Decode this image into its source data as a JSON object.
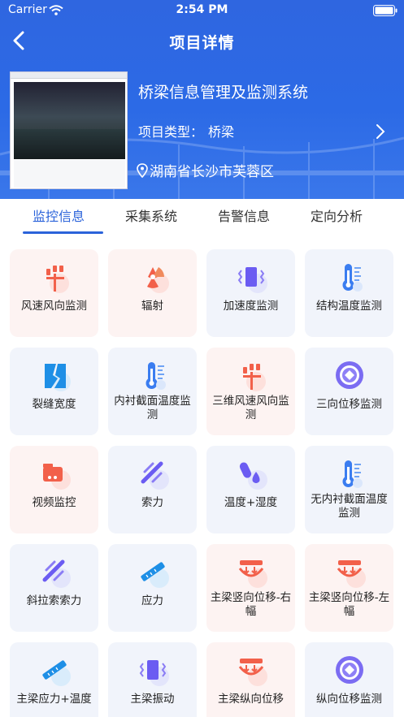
{
  "status_bar": {
    "carrier": "Carrier",
    "time": "2:54 PM"
  },
  "nav": {
    "title": "项目详情"
  },
  "project": {
    "name": "桥梁信息管理及监测系统",
    "type_label": "项目类型：",
    "type_value": "桥梁",
    "location": "湖南省长沙市芙蓉区"
  },
  "tabs": [
    {
      "label": "监控信息",
      "active": true
    },
    {
      "label": "采集系统",
      "active": false
    },
    {
      "label": "告警信息",
      "active": false
    },
    {
      "label": "定向分析",
      "active": false
    }
  ],
  "colors": {
    "header": "#2f66e0",
    "accent": "#2b63da",
    "warm_tile": "#fdf3f2",
    "cool_tile": "#f1f4fb"
  },
  "tiles": [
    {
      "label": "风速风向监测",
      "icon": "wind-vane-icon",
      "tone": "warm"
    },
    {
      "label": "辐射",
      "icon": "radiation-icon",
      "tone": "warm"
    },
    {
      "label": "加速度监测",
      "icon": "vibration-icon",
      "tone": "cool"
    },
    {
      "label": "结构温度监测",
      "icon": "thermometer-icon",
      "tone": "cool"
    },
    {
      "label": "裂缝宽度",
      "icon": "crack-icon",
      "tone": "cool"
    },
    {
      "label": "内衬截面温度监测",
      "icon": "thermometer-icon",
      "tone": "cool"
    },
    {
      "label": "三维风速风向监测",
      "icon": "wind-vane-icon",
      "tone": "warm"
    },
    {
      "label": "三向位移监测",
      "icon": "displacement-icon",
      "tone": "cool"
    },
    {
      "label": "视频监控",
      "icon": "camera-icon",
      "tone": "warm"
    },
    {
      "label": "索力",
      "icon": "cable-force-icon",
      "tone": "cool"
    },
    {
      "label": "温度+湿度",
      "icon": "temp-humidity-icon",
      "tone": "cool"
    },
    {
      "label": "无内衬截面温度监测",
      "icon": "thermometer-icon",
      "tone": "cool"
    },
    {
      "label": "斜拉索索力",
      "icon": "cable-force-icon",
      "tone": "cool"
    },
    {
      "label": "应力",
      "icon": "strain-gauge-icon",
      "tone": "cool"
    },
    {
      "label": "主梁竖向位移-右幅",
      "icon": "beam-deflection-icon",
      "tone": "warm"
    },
    {
      "label": "主梁竖向位移-左幅",
      "icon": "beam-deflection-icon",
      "tone": "warm"
    },
    {
      "label": "主梁应力+温度",
      "icon": "strain-gauge-icon",
      "tone": "cool"
    },
    {
      "label": "主梁振动",
      "icon": "vibration-icon",
      "tone": "cool"
    },
    {
      "label": "主梁纵向位移",
      "icon": "beam-deflection-icon",
      "tone": "warm"
    },
    {
      "label": "纵向位移监测",
      "icon": "displacement-icon",
      "tone": "cool"
    }
  ]
}
